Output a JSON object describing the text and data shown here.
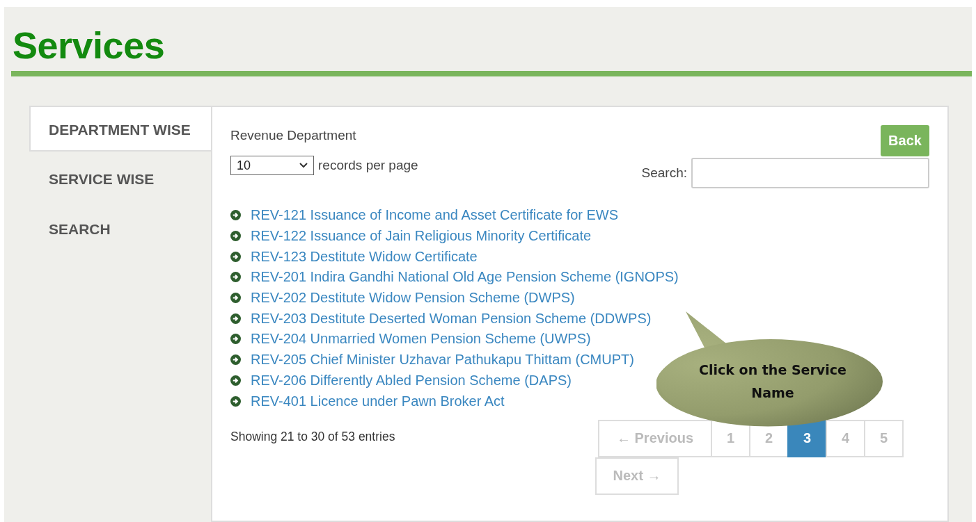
{
  "header": {
    "title": "Services"
  },
  "tabs": [
    {
      "label": "DEPARTMENT WISE",
      "selected": true
    },
    {
      "label": "SERVICE WISE",
      "selected": false
    },
    {
      "label": "SEARCH",
      "selected": false
    }
  ],
  "department": "Revenue Department",
  "back_button": "Back",
  "length_select": {
    "value": "10",
    "label": "records per page"
  },
  "search": {
    "label": "Search:"
  },
  "services": [
    {
      "label": "REV-121 Issuance of Income and Asset Certificate for EWS"
    },
    {
      "label": "REV-122 Issuance of Jain Religious Minority Certificate"
    },
    {
      "label": "REV-123 Destitute Widow Certificate"
    },
    {
      "label": "REV-201 Indira Gandhi National Old Age Pension Scheme (IGNOPS)"
    },
    {
      "label": "REV-202 Destitute Widow Pension Scheme (DWPS)"
    },
    {
      "label": "REV-203 Destitute Deserted Woman Pension Scheme (DDWPS)"
    },
    {
      "label": "REV-204 Unmarried Women Pension Scheme (UWPS)"
    },
    {
      "label": "REV-205 Chief Minister Uzhavar Pathukapu Thittam (CMUPT)"
    },
    {
      "label": "REV-206 Differently Abled Pension Scheme (DAPS)"
    },
    {
      "label": "REV-401 Licence under Pawn Broker Act"
    }
  ],
  "info": "Showing 21 to 30 of 53 entries",
  "pagination": {
    "previous": "← Previous",
    "next": "Next →",
    "pages": [
      {
        "label": "1",
        "selected": false
      },
      {
        "label": "2",
        "selected": false
      },
      {
        "label": "3",
        "selected": true
      },
      {
        "label": "4",
        "selected": false
      },
      {
        "label": "5",
        "selected": false
      }
    ]
  },
  "callout": {
    "text": "Click on the Service Name"
  }
}
